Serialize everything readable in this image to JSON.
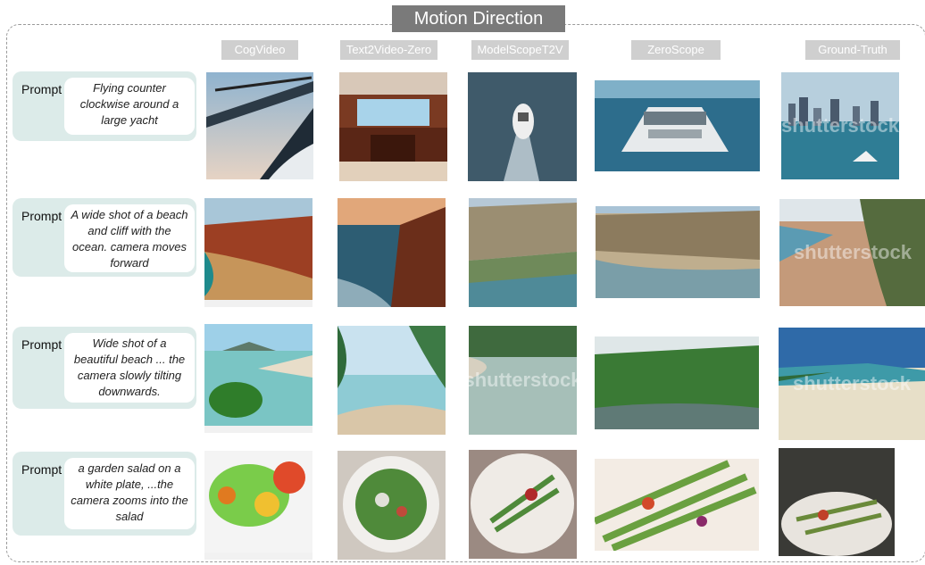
{
  "title": "Motion Direction",
  "columns": [
    "CogVideo",
    "Text2Video-Zero",
    "ModelScopeT2V",
    "ZeroScope",
    "Ground-Truth"
  ],
  "prompt_label": "Prompt",
  "rows": [
    {
      "prompt": "Flying counter clockwise around a large yacht"
    },
    {
      "prompt": "A wide shot of a beach and cliff with the ocean. camera moves forward"
    },
    {
      "prompt": "Wide shot of a beautiful beach ... the camera slowly tilting downwards."
    },
    {
      "prompt": "a garden salad on a white plate, ...the camera zooms into the salad"
    }
  ],
  "watermark": "shutterstock",
  "colors": {
    "title_bg": "#7a7a7a",
    "header_bg": "#cfcfcf",
    "prompt_bg": "#dcebe9"
  }
}
